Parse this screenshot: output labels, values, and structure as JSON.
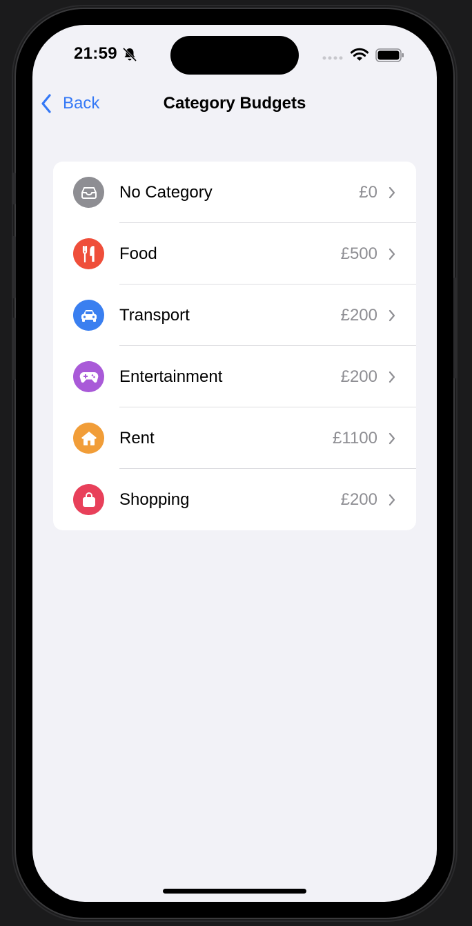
{
  "status_bar": {
    "time": "21:59"
  },
  "nav": {
    "back_label": "Back",
    "title": "Category Budgets"
  },
  "categories": [
    {
      "label": "No Category",
      "value": "£0",
      "icon": "tray-icon",
      "color": "#8e8e93"
    },
    {
      "label": "Food",
      "value": "£500",
      "icon": "fork-knife-icon",
      "color": "#ef4e3a"
    },
    {
      "label": "Transport",
      "value": "£200",
      "icon": "car-icon",
      "color": "#3a7ff0"
    },
    {
      "label": "Entertainment",
      "value": "£200",
      "icon": "gamecontroller-icon",
      "color": "#a95ad8"
    },
    {
      "label": "Rent",
      "value": "£1100",
      "icon": "house-icon",
      "color": "#f19d38"
    },
    {
      "label": "Shopping",
      "value": "£200",
      "icon": "bag-icon",
      "color": "#e8405a"
    }
  ]
}
